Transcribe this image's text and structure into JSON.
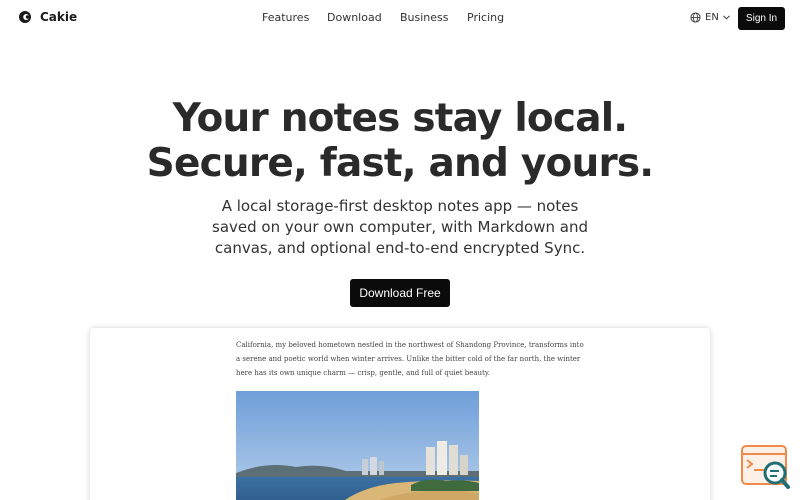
{
  "header": {
    "brand": "Cakie",
    "nav": [
      "Features",
      "Download",
      "Business",
      "Pricing"
    ],
    "language": "EN",
    "sign_in": "Sign In"
  },
  "hero": {
    "title_lines": [
      "Your notes stay local.",
      "Secure, fast, and yours."
    ],
    "subtitle_lines": [
      "A local storage-first desktop notes app — notes",
      "saved on your own computer, with Markdown and",
      "canvas, and optional end-to-end encrypted Sync."
    ],
    "cta": "Download Free"
  },
  "preview": {
    "text_lines": [
      "California, my beloved hometown nestled in the northwest of Shandong Province, transforms into",
      "a serene and poetic world when winter arrives. Unlike the bitter cold of the far north, the winter",
      "here has its own unique charm — crisp, gentle, and full of quiet beauty."
    ]
  },
  "colors": {
    "primary_button": "#0b0b0b",
    "widget_accent": "#f08a4b",
    "widget_teal": "#1f6f76"
  },
  "icons": {
    "logo": "cakie-logo-icon",
    "language": "globe-icon",
    "dropdown": "chevron-down-icon",
    "widget": "search-document-icon"
  }
}
